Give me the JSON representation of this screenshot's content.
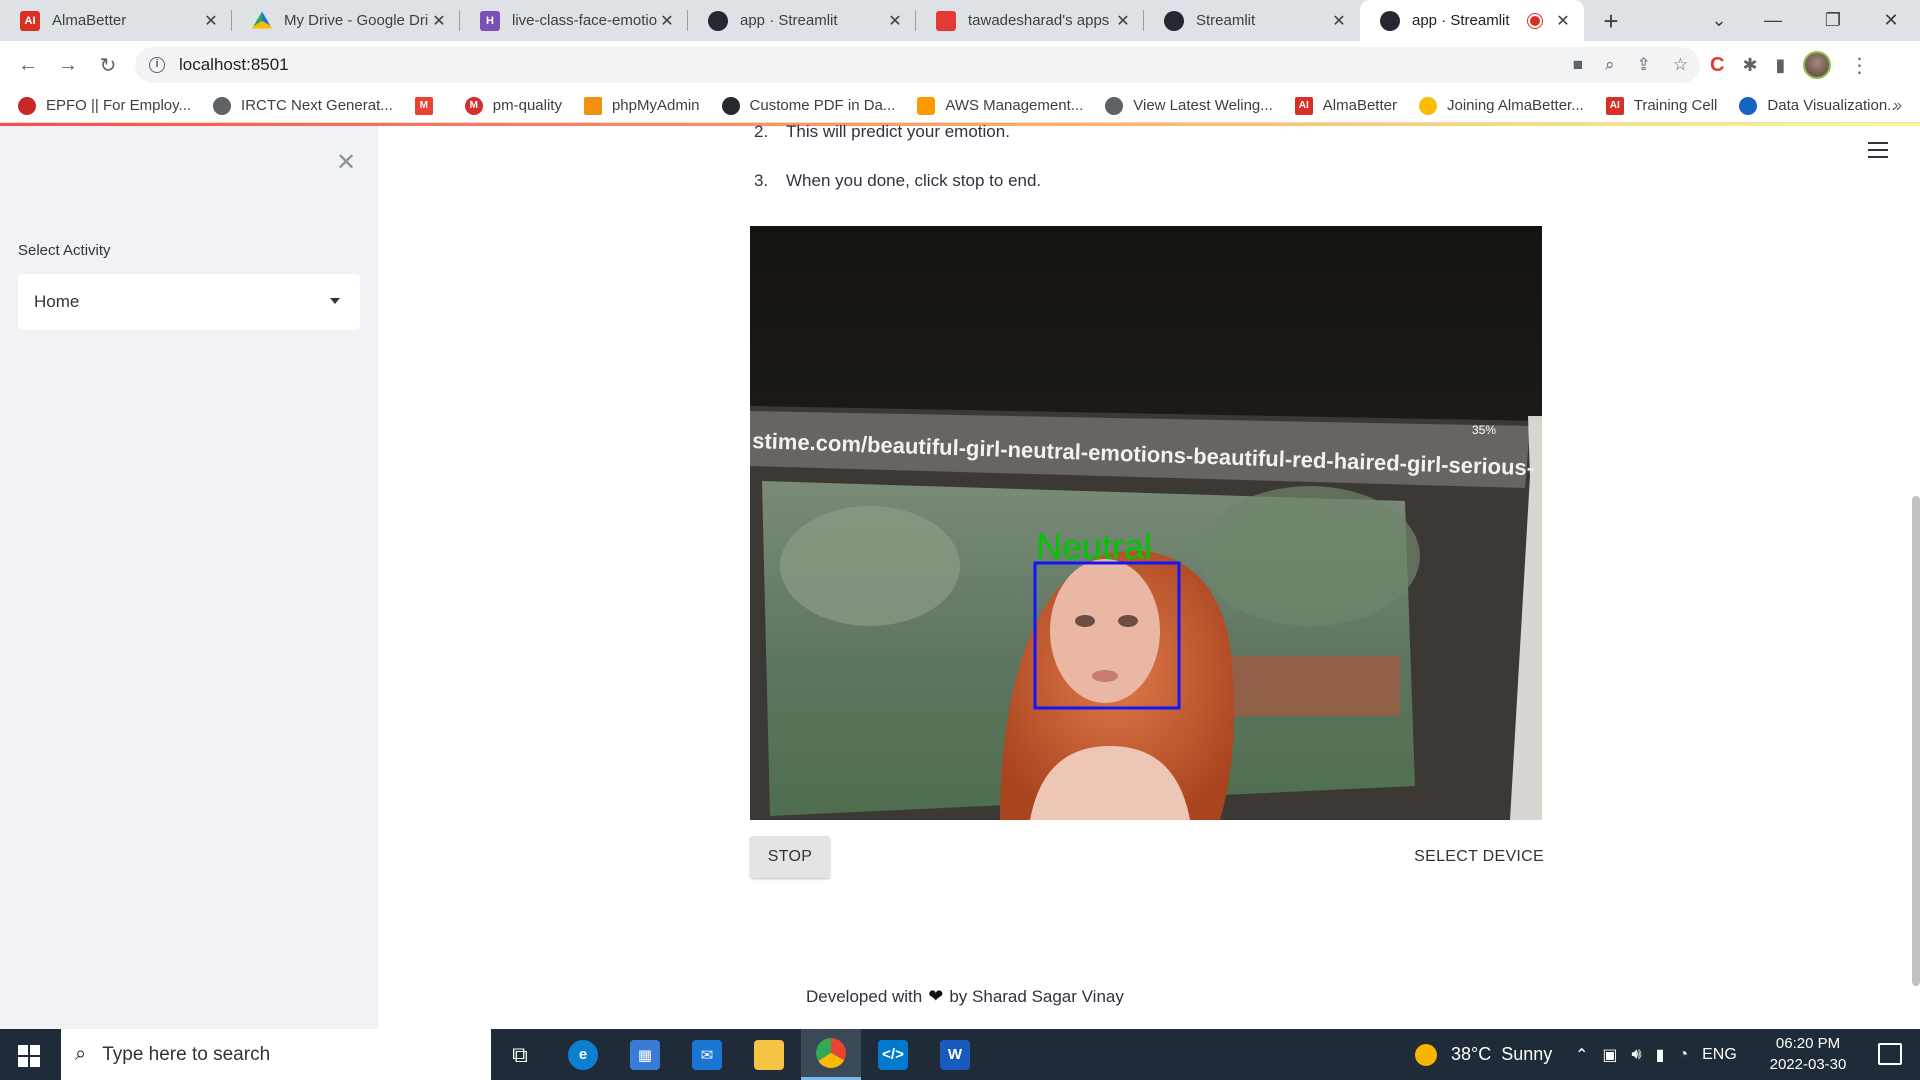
{
  "tabs": [
    {
      "title": "AlmaBetter",
      "favicon": "almabetter-icon"
    },
    {
      "title": "My Drive - Google Dri",
      "favicon": "google-drive-icon"
    },
    {
      "title": "live-class-face-emotio",
      "favicon": "heroku-icon"
    },
    {
      "title": "app · Streamlit",
      "favicon": "streamlit-icon"
    },
    {
      "title": "tawadesharad's apps",
      "favicon": "app-icon"
    },
    {
      "title": "Streamlit",
      "favicon": "streamlit-icon"
    },
    {
      "title": "app · Streamlit",
      "favicon": "streamlit-icon",
      "active": true,
      "recording": true
    }
  ],
  "address_bar": {
    "url": "localhost:8501"
  },
  "bookmarks": [
    {
      "label": "EPFO || For Employ...",
      "color": "#c62828"
    },
    {
      "label": "IRCTC Next Generat...",
      "color": "#5f6368"
    },
    {
      "label": "",
      "icon": "gmail-icon",
      "color": "#ea4335"
    },
    {
      "label": "pm-quality",
      "color": "#d32f2f"
    },
    {
      "label": "phpMyAdmin",
      "color": "#f29111"
    },
    {
      "label": "Custome PDF in Da...",
      "color": "#24292e"
    },
    {
      "label": "AWS Management...",
      "color": "#ff9900"
    },
    {
      "label": "View Latest Weling...",
      "color": "#5f6368"
    },
    {
      "label": "AlmaBetter",
      "color": "#d93025"
    },
    {
      "label": "Joining AlmaBetter...",
      "color": "#fbbc04"
    },
    {
      "label": "Training Cell",
      "color": "#d93025"
    },
    {
      "label": "Data Visualization...",
      "color": "#1565c0"
    }
  ],
  "sidebar": {
    "select_label": "Select Activity",
    "select_value": "Home"
  },
  "main": {
    "instructions": [
      {
        "num": "2.",
        "text": "This will predict your emotion."
      },
      {
        "num": "3.",
        "text": "When you done, click stop to end."
      }
    ],
    "video": {
      "screen_url_text": "stime.com/beautiful-girl-neutral-emotions-beautiful-red-haired-girl-serious-",
      "status_text": "35%",
      "emotion_label": "Neutral",
      "label_color": "#00c800",
      "box_color": "#1414ff"
    },
    "stop_button": "STOP",
    "select_device_button": "SELECT DEVICE",
    "footer_prefix": "Developed with",
    "footer_suffix": "by Sharad Sagar Vinay"
  },
  "taskbar": {
    "search_placeholder": "Type here to search",
    "weather": "38°C  Sunny",
    "language": "ENG",
    "time": "06:20 PM",
    "date": "2022-03-30"
  }
}
